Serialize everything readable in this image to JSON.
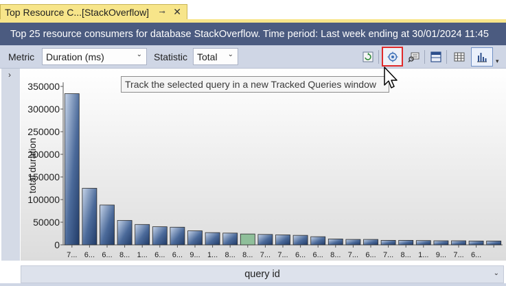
{
  "tab": {
    "title": "Top Resource C...[StackOverflow]",
    "pin_glyph": "⊸",
    "close_glyph": "✕"
  },
  "header": {
    "text": "Top 25 resource consumers for database StackOverflow. Time period: Last week ending at 30/01/2024 11:45"
  },
  "toolbar": {
    "metric_label": "Metric",
    "metric_value": "Duration (ms)",
    "statistic_label": "Statistic",
    "statistic_value": "Total",
    "buttons": [
      {
        "name": "refresh-icon"
      },
      {
        "name": "track-query-icon"
      },
      {
        "name": "view-plan-icon"
      },
      {
        "name": "grid-view-icon"
      },
      {
        "name": "table-view-icon"
      },
      {
        "name": "chart-view-icon"
      }
    ]
  },
  "tooltip": {
    "text": "Track the selected query in a new Tracked Queries window"
  },
  "expander": {
    "glyph": "›"
  },
  "chart_data": {
    "type": "bar",
    "xlabel": "query id",
    "ylabel": "total duration",
    "ylim": [
      0,
      350000
    ],
    "y_ticks": [
      "0",
      "50000",
      "100000",
      "150000",
      "200000",
      "250000",
      "300000",
      "350000"
    ],
    "categories": [
      "7...",
      "6...",
      "6...",
      "8...",
      "1...",
      "6...",
      "6...",
      "9...",
      "1...",
      "8...",
      "8...",
      "7...",
      "7...",
      "6...",
      "6...",
      "8...",
      "7...",
      "6...",
      "7...",
      "8...",
      "1...",
      "9...",
      "7...",
      "6..."
    ],
    "values": [
      334000,
      125000,
      88000,
      54000,
      45000,
      40000,
      39000,
      31000,
      27000,
      26000,
      24000,
      23000,
      22000,
      21000,
      18000,
      13000,
      12000,
      12000,
      10000,
      10000,
      9500,
      9000,
      9000,
      8500,
      8500
    ],
    "selected_index": 10,
    "colors": {
      "bar": "#2e4a77",
      "bar_highlight": "#c7d5ea",
      "selected": "#8fbf9a"
    }
  },
  "x_axis_dropdown": {
    "label": "query id",
    "chevron": "⌄"
  }
}
